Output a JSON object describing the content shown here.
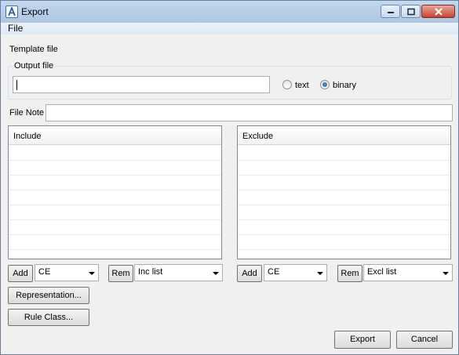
{
  "window": {
    "title": "Export"
  },
  "menu": {
    "file": "File"
  },
  "template_file_label": "Template file",
  "output_file": {
    "group_label": "Output file",
    "value": "",
    "options": [
      "text",
      "binary"
    ],
    "selected": "binary"
  },
  "file_note": {
    "label": "File Note",
    "value": ""
  },
  "include": {
    "header": "Include",
    "add_label": "Add",
    "type_combo": "CE",
    "rem_label": "Rem",
    "list_combo": "Inc list"
  },
  "exclude": {
    "header": "Exclude",
    "add_label": "Add",
    "type_combo": "CE",
    "rem_label": "Rem",
    "list_combo": "Excl list"
  },
  "buttons": {
    "representation": "Representation...",
    "rule_class": "Rule Class...",
    "export": "Export",
    "cancel": "Cancel"
  },
  "icons": {
    "app": "app-logo-icon",
    "minimize": "minimize-icon",
    "maximize": "maximize-icon",
    "close": "close-icon"
  }
}
